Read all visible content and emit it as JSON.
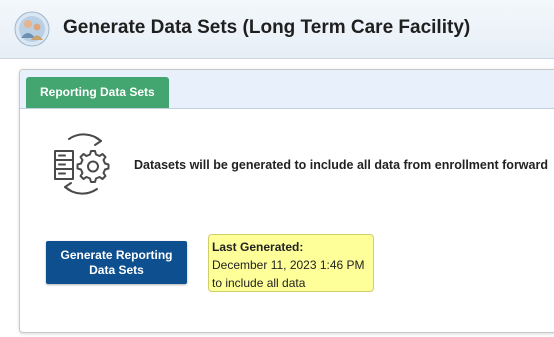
{
  "header": {
    "title": "Generate Data Sets (Long Term Care Facility)",
    "logo_icon": "nhsn-logo-icon"
  },
  "tabs": [
    {
      "label": "Reporting Data Sets",
      "selected": true,
      "color": "#43a56f"
    }
  ],
  "main": {
    "icon": "dataset-gear-refresh-icon",
    "info_text": "Datasets will be generated to include all data from enrollment forward",
    "generate_button": {
      "label": "Generate Reporting Data Sets",
      "color": "#0d4f8f"
    },
    "last_generated": {
      "label": "Last Generated:",
      "datetime": "December 11, 2023 1:46 PM",
      "scope": "to include all data",
      "background": "#ffff99"
    }
  }
}
